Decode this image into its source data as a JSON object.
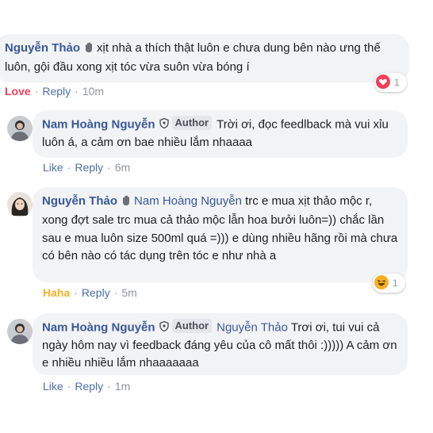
{
  "comments": [
    {
      "name": "Nguyễn Thảo",
      "text": "xịt nhà a thích thật luôn e chưa dung bên nào ưng thế luôn, gội đầu xong xịt tóc vừa suôn vừa bóng í",
      "reaction_label": "Love",
      "reply_label": "Reply",
      "time": "10m",
      "reaction_count": "1"
    },
    {
      "name": "Nam Hoàng Nguyễn",
      "author_badge": "Author",
      "text": "Trời ơi, đọc feedlback mà vui xỉu luôn á, a cảm ơn bae nhiều lắm nhaaaa",
      "like_label": "Like",
      "reply_label": "Reply",
      "time": "6m"
    },
    {
      "name": "Nguyễn Thảo",
      "tag": "Nam Hoàng Nguyễn",
      "text": "trc e mua xịt thảo mộc r, xong đợt sale trc mua cả thảo mộc lẫn hoa bưởi luôn=)) chắc lần sau e mua luôn size 500ml quá =))) e dùng nhiều hãng rồi mà chưa có bên nào có tác dụng trên tóc e như nhà a",
      "reaction_label": "Haha",
      "reply_label": "Reply",
      "time": "5m",
      "reaction_count": "1"
    },
    {
      "name": "Nam Hoàng Nguyễn",
      "author_badge": "Author",
      "tag": "Nguyễn Thảo",
      "text": "Trơi ơi, tui vui cả ngày hôm nay vì feedback đáng yêu của cô mất thôi :))))) A cảm ơn e nhiều nhiều lắm nhaaaaaaa",
      "like_label": "Like",
      "reply_label": "Reply",
      "time": "1m"
    }
  ],
  "separator": "·",
  "icons": {
    "wave": "waving-hand-icon",
    "shield": "shield-icon",
    "love": "love-reaction-icon",
    "haha": "haha-reaction-icon"
  },
  "colors": {
    "name": "#385898",
    "bubble": "#f2f3f5",
    "love": "#f33e58",
    "haha": "#f7b125",
    "meta": "#90949c"
  }
}
